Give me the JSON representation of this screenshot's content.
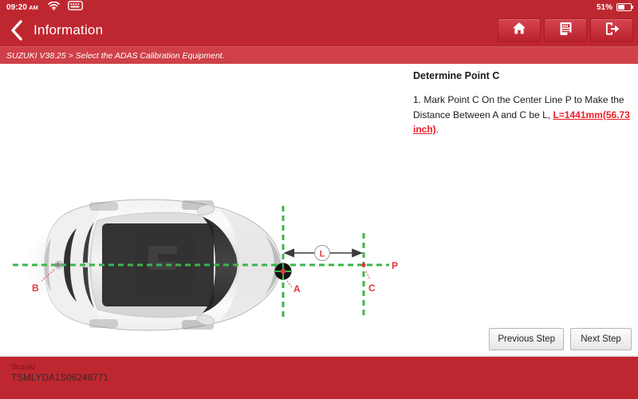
{
  "statusbar": {
    "time": "09:20",
    "ampm": "AM",
    "wifi_icon": "wifi-icon",
    "vci_icon": "vci-connection-icon",
    "battery_percent": "51%",
    "battery_icon": "battery-icon"
  },
  "header": {
    "back_icon": "back-chevron-icon",
    "title": "Information",
    "tools": [
      {
        "name": "home-button",
        "icon": "home-icon"
      },
      {
        "name": "report-button",
        "icon": "report-icon"
      },
      {
        "name": "exit-button",
        "icon": "exit-icon"
      }
    ]
  },
  "breadcrumb": {
    "text": "SUZUKI V38.25 > Select the ADAS Calibration Equipment."
  },
  "info": {
    "title": "Determine Point C",
    "step_prefix": "1. Mark Point C On the Center Line P to Make the Distance Between A and C be L, ",
    "highlight": "L=1441mm(56.73 inch)",
    "step_suffix": "."
  },
  "diagram": {
    "labels": {
      "point_a": "A",
      "point_b": "B",
      "point_c": "C",
      "line_p": "P",
      "dimension_l": "L"
    },
    "colors": {
      "guide_green": "#3cb54a",
      "label_red": "#e3353f",
      "dimension_line": "#3b3b3b"
    },
    "vehicle": "suzuki-sedan-top-view"
  },
  "buttons": {
    "previous": "Previous Step",
    "next": "Next Step"
  },
  "bottombar": {
    "make": "Suzuki",
    "vin": "TSMLYDA1S06248771"
  },
  "theme": {
    "brand_red": "#bf2730",
    "breadcrumb_red": "#cf4049",
    "accent_red": "#ee1c25"
  }
}
